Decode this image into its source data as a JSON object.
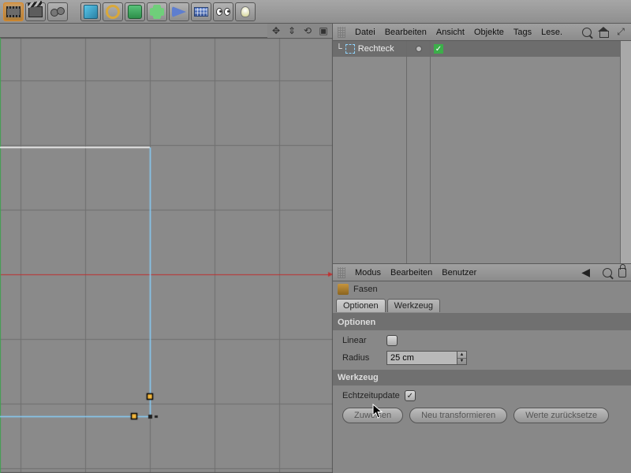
{
  "toolbar": {
    "icons": [
      "film",
      "clapper",
      "cogs",
      "cube",
      "torus",
      "hypernurbs",
      "flower",
      "wedge",
      "grid",
      "eyes",
      "bulb"
    ]
  },
  "viewport": {
    "nav_icons": [
      "move",
      "zoom",
      "rotate",
      "maximize"
    ]
  },
  "object_manager": {
    "menu": [
      "Datei",
      "Bearbeiten",
      "Ansicht",
      "Objekte",
      "Tags",
      "Lese."
    ],
    "object_name": "Rechteck"
  },
  "attributes": {
    "menu": [
      "Modus",
      "Bearbeiten",
      "Benutzer"
    ],
    "tool_name": "Fasen",
    "tabs": [
      "Optionen",
      "Werkzeug"
    ],
    "section_optionen": "Optionen",
    "linear_label": "Linear",
    "radius_label": "Radius",
    "radius_value": "25 cm",
    "section_werkzeug": "Werkzeug",
    "realtime_label": "Echtzeitupdate",
    "buttons": {
      "apply": "Zuweisen",
      "new_transform": "Neu transformieren",
      "reset": "Werte zurücksetze"
    }
  }
}
